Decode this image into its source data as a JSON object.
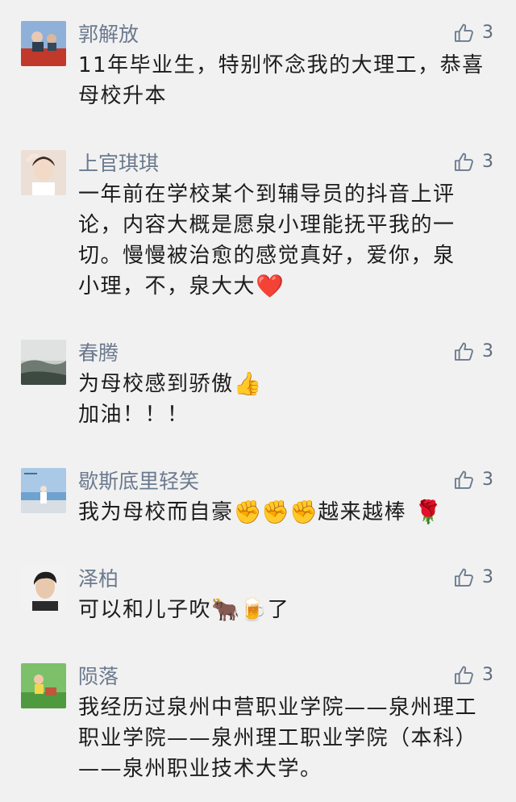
{
  "comments": [
    {
      "name": "郭解放",
      "likes": "3",
      "lines": [
        "11年毕业生，特别怀念我的大理工，恭喜",
        "母校升本"
      ]
    },
    {
      "name": "上官琪琪",
      "likes": "3",
      "lines": [
        "一年前在学校某个到辅导员的抖音上评",
        "论，内容大概是愿泉小理能抚平我的一",
        "切。慢慢被治愈的感觉真好，爱你，泉",
        "小理，不，泉大大"
      ],
      "emoji_end": "❤️"
    },
    {
      "name": "春腾",
      "likes": "3",
      "line1": "为母校感到骄傲",
      "emoji1": "👍",
      "line2": "加油！！！"
    },
    {
      "name": "歇斯底里轻笑",
      "likes": "3",
      "text_a": "我为母校而自豪",
      "emoji_a": "✊✊✊",
      "text_b": "越来越棒",
      "emoji_b": "🌹"
    },
    {
      "name": "泽柏",
      "likes": "3",
      "text_a": "可以和儿子吹",
      "emoji_a": "🐂🍺",
      "text_b": "了"
    },
    {
      "name": "陨落",
      "likes": "3",
      "lines": [
        "我经历过泉州中营职业学院——泉州理工",
        "职业学院——泉州理工职业学院（本科）",
        "——泉州职业技术大学。"
      ]
    }
  ],
  "icons": {
    "like": "thumbs-up-outline-icon"
  },
  "colors": {
    "background": "#f1f1f1",
    "name": "#6b7a8e",
    "text": "#1c1c1c"
  }
}
